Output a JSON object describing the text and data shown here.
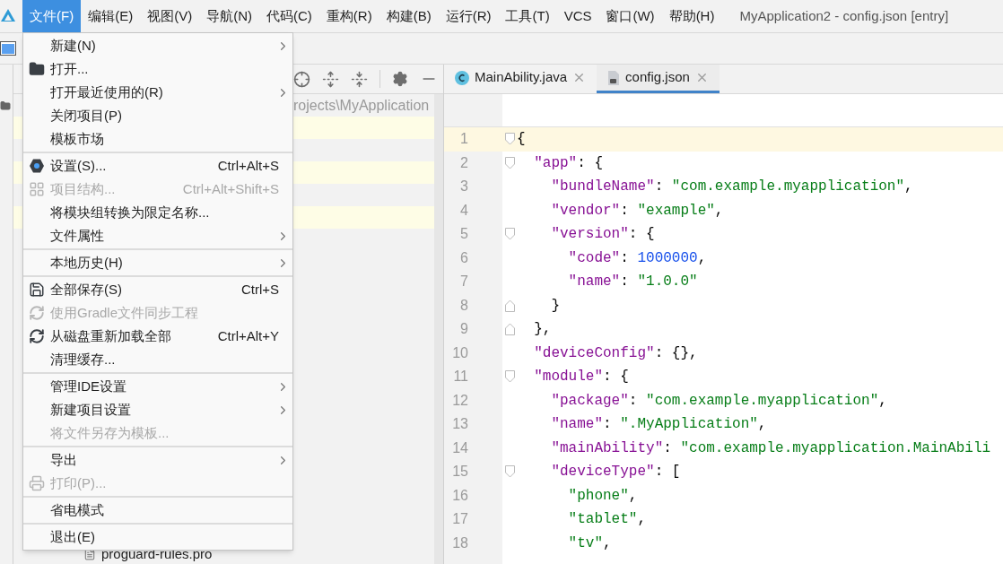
{
  "menubar": {
    "items": [
      {
        "label": "文件(F)",
        "selected": true
      },
      {
        "label": "编辑(E)",
        "selected": false
      },
      {
        "label": "视图(V)",
        "selected": false
      },
      {
        "label": "导航(N)",
        "selected": false
      },
      {
        "label": "代码(C)",
        "selected": false
      },
      {
        "label": "重构(R)",
        "selected": false
      },
      {
        "label": "构建(B)",
        "selected": false
      },
      {
        "label": "运行(R)",
        "selected": false
      },
      {
        "label": "工具(T)",
        "selected": false
      },
      {
        "label": "VCS",
        "selected": false
      },
      {
        "label": "窗口(W)",
        "selected": false
      },
      {
        "label": "帮助(H)",
        "selected": false
      }
    ],
    "title": "MyApplication2 - config.json [entry]"
  },
  "file_menu": {
    "groups": [
      {
        "items": [
          {
            "label": "新建(N)",
            "submenu": true,
            "disabled": false
          },
          {
            "label": "打开...",
            "kind": "folder",
            "submenu": false,
            "disabled": false
          },
          {
            "label": "打开最近使用的(R)",
            "submenu": true,
            "disabled": false
          },
          {
            "label": "关闭项目(P)",
            "submenu": false,
            "disabled": false
          },
          {
            "label": "模板市场",
            "submenu": false,
            "disabled": false
          }
        ]
      },
      {
        "items": [
          {
            "label": "设置(S)...",
            "kind": "settings",
            "shortcut": "Ctrl+Alt+S",
            "submenu": false,
            "disabled": false
          },
          {
            "label": "项目结构...",
            "kind": "structure",
            "shortcut": "Ctrl+Alt+Shift+S",
            "submenu": false,
            "disabled": true
          },
          {
            "label": "将模块组转换为限定名称...",
            "submenu": false,
            "disabled": false
          },
          {
            "label": "文件属性",
            "submenu": true,
            "disabled": false
          }
        ]
      },
      {
        "items": [
          {
            "label": "本地历史(H)",
            "submenu": true,
            "disabled": false
          }
        ]
      },
      {
        "items": [
          {
            "label": "全部保存(S)",
            "kind": "save",
            "shortcut": "Ctrl+S",
            "submenu": false,
            "disabled": false
          },
          {
            "label": "使用Gradle文件同步工程",
            "kind": "sync",
            "submenu": false,
            "disabled": true
          },
          {
            "label": "从磁盘重新加载全部",
            "kind": "sync",
            "shortcut": "Ctrl+Alt+Y",
            "submenu": false,
            "disabled": false
          },
          {
            "label": "清理缓存...",
            "submenu": false,
            "disabled": false
          }
        ]
      },
      {
        "items": [
          {
            "label": "管理IDE设置",
            "submenu": true,
            "disabled": false
          },
          {
            "label": "新建项目设置",
            "submenu": true,
            "disabled": false
          },
          {
            "label": "将文件另存为模板...",
            "submenu": false,
            "disabled": true
          }
        ]
      },
      {
        "items": [
          {
            "label": "导出",
            "submenu": true,
            "disabled": false
          },
          {
            "label": "打印(P)...",
            "kind": "printer",
            "submenu": false,
            "disabled": true
          }
        ]
      },
      {
        "items": [
          {
            "label": "省电模式",
            "submenu": false,
            "disabled": false
          }
        ]
      },
      {
        "items": [
          {
            "label": "退出(E)",
            "submenu": false,
            "disabled": false
          }
        ]
      }
    ]
  },
  "project_panel": {
    "path": "rojects\\MyApplication",
    "files": [
      {
        "name": "proguard-rules.pro"
      }
    ]
  },
  "editor": {
    "tabs": [
      {
        "label": "MainAbility.java",
        "kind": "class",
        "selected": false
      },
      {
        "label": "config.json",
        "kind": "json",
        "selected": true
      }
    ],
    "lines": [
      {
        "number": "1",
        "fold_start": true,
        "fold_end": false,
        "current": true,
        "tokens": [
          {
            "kind": "punct",
            "text": "{"
          }
        ]
      },
      {
        "number": "2",
        "fold_start": true,
        "fold_end": false,
        "current": false,
        "tokens": [
          {
            "kind": "key",
            "text": "  \"app\""
          },
          {
            "kind": "punct",
            "text": ": {"
          }
        ]
      },
      {
        "number": "3",
        "fold_start": false,
        "fold_end": false,
        "current": false,
        "tokens": [
          {
            "kind": "key",
            "text": "    \"bundleName\""
          },
          {
            "kind": "punct",
            "text": ": "
          },
          {
            "kind": "string",
            "text": "\"com.example.myapplication\""
          },
          {
            "kind": "punct",
            "text": ","
          }
        ]
      },
      {
        "number": "4",
        "fold_start": false,
        "fold_end": false,
        "current": false,
        "tokens": [
          {
            "kind": "key",
            "text": "    \"vendor\""
          },
          {
            "kind": "punct",
            "text": ": "
          },
          {
            "kind": "string",
            "text": "\"example\""
          },
          {
            "kind": "punct",
            "text": ","
          }
        ]
      },
      {
        "number": "5",
        "fold_start": true,
        "fold_end": false,
        "current": false,
        "tokens": [
          {
            "kind": "key",
            "text": "    \"version\""
          },
          {
            "kind": "punct",
            "text": ": {"
          }
        ]
      },
      {
        "number": "6",
        "fold_start": false,
        "fold_end": false,
        "current": false,
        "tokens": [
          {
            "kind": "key",
            "text": "      \"code\""
          },
          {
            "kind": "punct",
            "text": ": "
          },
          {
            "kind": "number",
            "text": "1000000"
          },
          {
            "kind": "punct",
            "text": ","
          }
        ]
      },
      {
        "number": "7",
        "fold_start": false,
        "fold_end": false,
        "current": false,
        "tokens": [
          {
            "kind": "key",
            "text": "      \"name\""
          },
          {
            "kind": "punct",
            "text": ": "
          },
          {
            "kind": "string",
            "text": "\"1.0.0\""
          }
        ]
      },
      {
        "number": "8",
        "fold_start": false,
        "fold_end": true,
        "current": false,
        "tokens": [
          {
            "kind": "punct",
            "text": "    }"
          }
        ]
      },
      {
        "number": "9",
        "fold_start": false,
        "fold_end": true,
        "current": false,
        "tokens": [
          {
            "kind": "punct",
            "text": "  },"
          }
        ]
      },
      {
        "number": "10",
        "fold_start": false,
        "fold_end": false,
        "current": false,
        "tokens": [
          {
            "kind": "key",
            "text": "  \"deviceConfig\""
          },
          {
            "kind": "punct",
            "text": ": {},"
          }
        ]
      },
      {
        "number": "11",
        "fold_start": true,
        "fold_end": false,
        "current": false,
        "tokens": [
          {
            "kind": "key",
            "text": "  \"module\""
          },
          {
            "kind": "punct",
            "text": ": {"
          }
        ]
      },
      {
        "number": "12",
        "fold_start": false,
        "fold_end": false,
        "current": false,
        "tokens": [
          {
            "kind": "key",
            "text": "    \"package\""
          },
          {
            "kind": "punct",
            "text": ": "
          },
          {
            "kind": "string",
            "text": "\"com.example.myapplication\""
          },
          {
            "kind": "punct",
            "text": ","
          }
        ]
      },
      {
        "number": "13",
        "fold_start": false,
        "fold_end": false,
        "current": false,
        "tokens": [
          {
            "kind": "key",
            "text": "    \"name\""
          },
          {
            "kind": "punct",
            "text": ": "
          },
          {
            "kind": "string",
            "text": "\".MyApplication\""
          },
          {
            "kind": "punct",
            "text": ","
          }
        ]
      },
      {
        "number": "14",
        "fold_start": false,
        "fold_end": false,
        "current": false,
        "tokens": [
          {
            "kind": "key",
            "text": "    \"mainAbility\""
          },
          {
            "kind": "punct",
            "text": ": "
          },
          {
            "kind": "string",
            "text": "\"com.example.myapplication.MainAbili"
          }
        ]
      },
      {
        "number": "15",
        "fold_start": true,
        "fold_end": false,
        "current": false,
        "tokens": [
          {
            "kind": "key",
            "text": "    \"deviceType\""
          },
          {
            "kind": "punct",
            "text": ": ["
          }
        ]
      },
      {
        "number": "16",
        "fold_start": false,
        "fold_end": false,
        "current": false,
        "tokens": [
          {
            "kind": "string",
            "text": "      \"phone\""
          },
          {
            "kind": "punct",
            "text": ","
          }
        ]
      },
      {
        "number": "17",
        "fold_start": false,
        "fold_end": false,
        "current": false,
        "tokens": [
          {
            "kind": "string",
            "text": "      \"tablet\""
          },
          {
            "kind": "punct",
            "text": ","
          }
        ]
      },
      {
        "number": "18",
        "fold_start": false,
        "fold_end": false,
        "current": false,
        "tokens": [
          {
            "kind": "string",
            "text": "      \"tv\""
          },
          {
            "kind": "punct",
            "text": ","
          }
        ]
      }
    ]
  }
}
